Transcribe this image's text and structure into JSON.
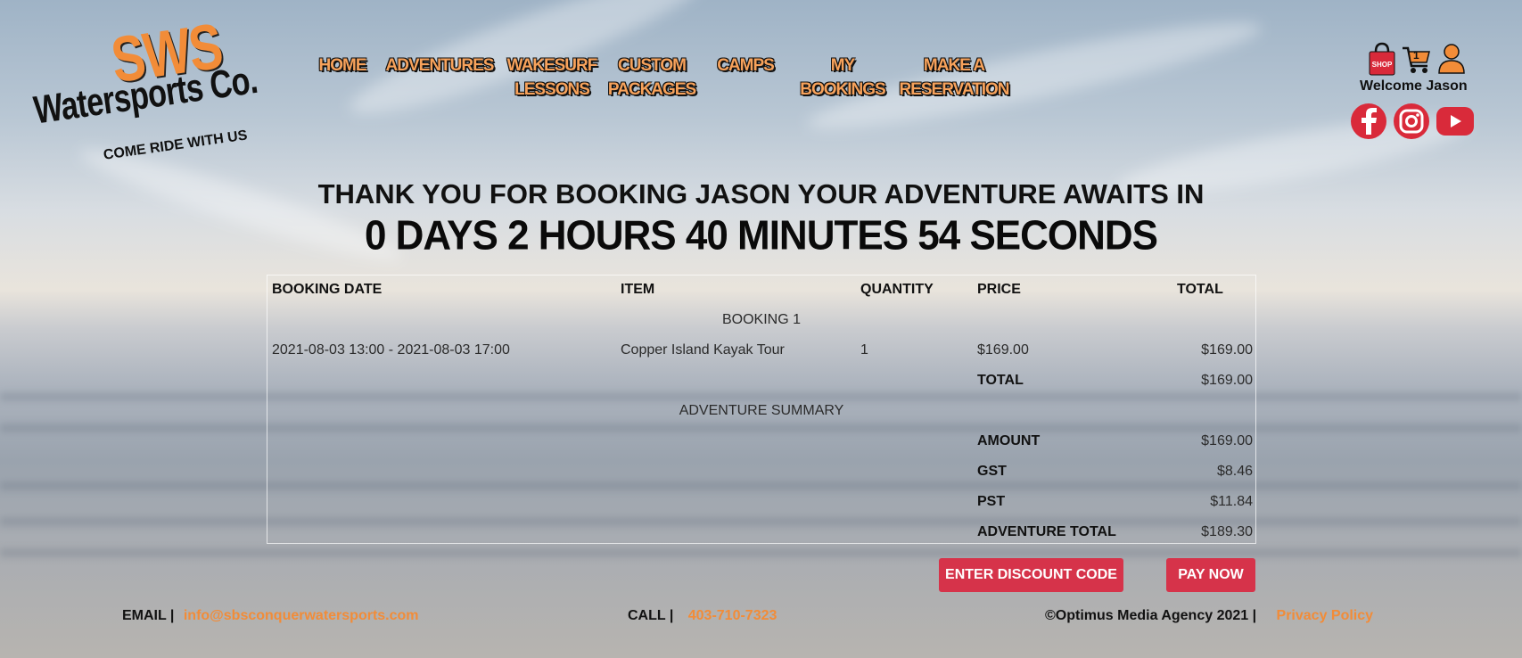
{
  "logo": {
    "main": "SWS",
    "name": "Watersports Co.",
    "tagline": "COME RIDE WITH US"
  },
  "nav": [
    {
      "label": "HOME"
    },
    {
      "label": "ADVENTURES"
    },
    {
      "label": "WAKESURF\nLESSONS"
    },
    {
      "label": "CUSTOM\nPACKAGES"
    },
    {
      "label": "CAMPS"
    },
    {
      "label": "MY\nBOOKINGS"
    },
    {
      "label": "MAKE A\nRESERVATION"
    }
  ],
  "header_right": {
    "shop_label": "SHOP",
    "cart_count": "1",
    "welcome": "Welcome Jason",
    "shop_icon": "shopping-bag-icon",
    "cart_icon": "cart-icon",
    "user_icon": "user-icon",
    "social": [
      "facebook-icon",
      "instagram-icon",
      "youtube-icon"
    ]
  },
  "confirmation": {
    "thanks": "THANK YOU FOR BOOKING JASON YOUR ADVENTURE AWAITS IN",
    "countdown": "0 DAYS 2 HOURS 40 MINUTES 54 SECONDS"
  },
  "table": {
    "headers": {
      "date": "BOOKING DATE",
      "item": "ITEM",
      "qty": "QUANTITY",
      "price": "PRICE",
      "total": "TOTAL"
    },
    "booking_label": "BOOKING 1",
    "row": {
      "date": "2021-08-03 13:00 - 2021-08-03 17:00",
      "item": "Copper Island Kayak Tour",
      "qty": "1",
      "price": "$169.00",
      "total": "$169.00"
    },
    "booking_total": {
      "label": "TOTAL",
      "value": "$169.00"
    },
    "summary_label": "ADVENTURE SUMMARY",
    "summary": {
      "amount": {
        "label": "AMOUNT",
        "value": "$169.00"
      },
      "gst": {
        "label": "GST",
        "value": "$8.46"
      },
      "pst": {
        "label": "PST",
        "value": "$11.84"
      },
      "adventure_total": {
        "label": "ADVENTURE TOTAL",
        "value": "$189.30"
      }
    }
  },
  "buttons": {
    "discount": "ENTER DISCOUNT CODE",
    "pay": "PAY NOW"
  },
  "footer": {
    "email_label": "EMAIL |",
    "email": "info@sbsconquerwatersports.com",
    "call_label": "CALL |",
    "phone": "403-710-7323",
    "copyright": "©Optimus Media Agency 2021 |",
    "privacy": "Privacy Policy"
  },
  "colors": {
    "accent": "#f28c38",
    "button": "#d6334a",
    "social": "#d92a3a"
  }
}
